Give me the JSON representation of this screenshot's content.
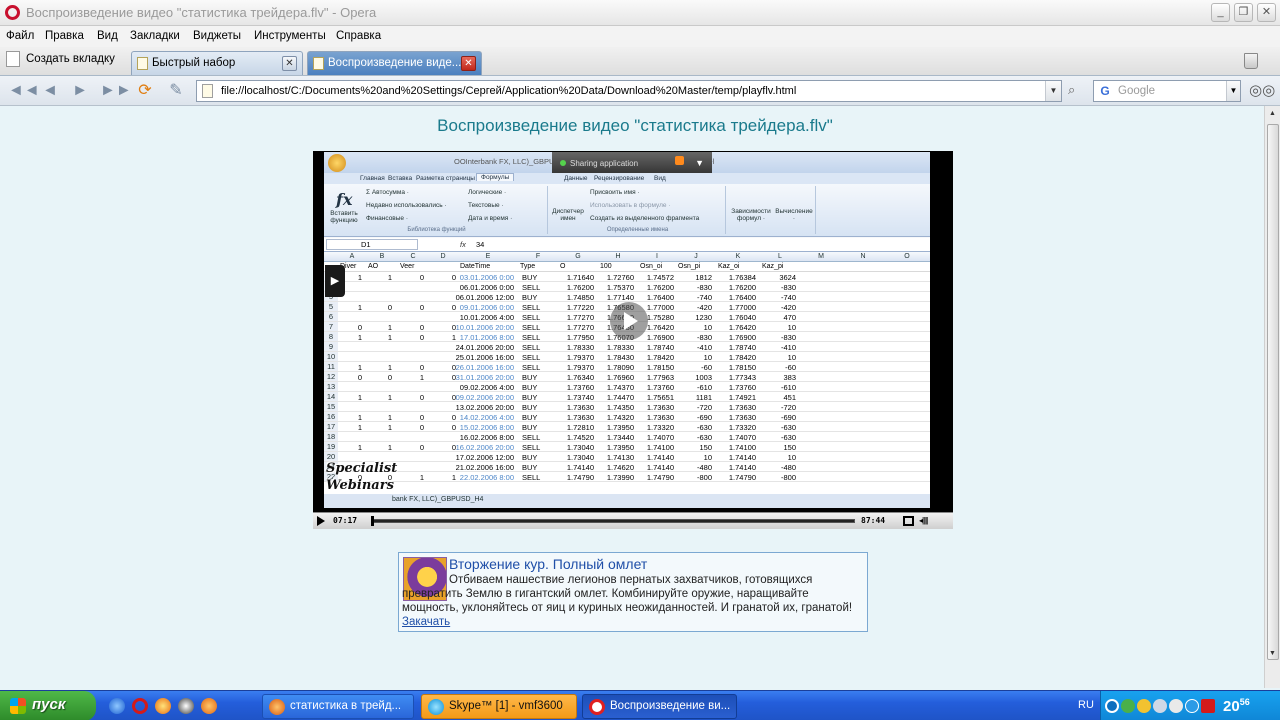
{
  "window": {
    "title": "Воспроизведение видео \"статистика трейдера.flv\" - Opera",
    "minimize": "_",
    "maximize": "❐",
    "close": "✕"
  },
  "menu": [
    "Файл",
    "Правка",
    "Вид",
    "Закладки",
    "Виджеты",
    "Инструменты",
    "Справка"
  ],
  "tabs": {
    "new_tab": "Создать вкладку",
    "items": [
      {
        "label": "Быстрый набор",
        "active": false
      },
      {
        "label": "Воспроизведение виде...",
        "active": true
      }
    ],
    "close_glyph": "✕"
  },
  "nav": {
    "back": "◄◄",
    "back_single": "◄",
    "forward_single": "►",
    "forward": "►►",
    "reload": "⟳",
    "edit": "✎",
    "url": "file://localhost/C:/Documents%20and%20Settings/Сергей/Application%20Data/Download%20Master/temp/playflv.html",
    "search_placeholder": "Google",
    "search_engine_glyph": "G",
    "dropdown_glyph": "▼"
  },
  "page": {
    "heading": "Воспроизведение видео \"статистика трейдера.flv\""
  },
  "video": {
    "excel_title": "OOInterbank FX, LLC)_GBPUSD... (Режим совместимости) - Microsoft Excel",
    "sharing_label": "Sharing application",
    "ribbon_tabs": [
      "Главная",
      "Вставка",
      "Разметка страницы",
      "Формулы",
      "Данные",
      "Рецензирование",
      "Вид"
    ],
    "active_ribbon_tab": "Формулы",
    "ribbon": {
      "insert_function": "Вставить функцию",
      "autosum": "Σ Автосумма ·",
      "recent": "Недавно использовались ·",
      "financial": "Финансовые ·",
      "logical": "Логические ·",
      "text": "Текстовые ·",
      "datetime": "Дата и время ·",
      "lib_caption": "Библиотека функций",
      "name_manager": "Диспетчер имен",
      "assign_name": "Присвоить имя ·",
      "use_in_formula": "Использовать в формуле ·",
      "create_from_sel": "Создать из выделенного фрагмента",
      "names_caption": "Определенные имена",
      "dependencies": "Зависимости формул ·",
      "calculation": "Вычисление ·"
    },
    "name_box": "D1",
    "formula_value": "34",
    "fx_label": "fx",
    "columns": [
      "A",
      "B",
      "C",
      "D",
      "E",
      "F",
      "G",
      "H",
      "I",
      "J",
      "K",
      "L",
      "M",
      "N",
      "O"
    ],
    "header_row": [
      "Diver",
      "AO",
      "Veer",
      "",
      "DateTime",
      "Type",
      "O",
      "100",
      "Osn_oi",
      "Osn_pi",
      "Kaz_oi",
      "Kaz_pi"
    ],
    "rows": [
      {
        "n": "3",
        "a": "1",
        "b": "1",
        "c": "0",
        "d": "0",
        "dt": "03.01.2006 0:00",
        "blue": true,
        "type": "BUY",
        "g": "1.71640",
        "h": "1.72760",
        "i": "1.74572",
        "j": "1812",
        "k": "1.76384",
        "l": "3624"
      },
      {
        "n": "4",
        "a": "",
        "b": "",
        "c": "",
        "d": "",
        "dt": "06.01.2006 0:00",
        "blue": false,
        "type": "SELL",
        "g": "1.76200",
        "h": "1.75370",
        "i": "1.76200",
        "j": "-830",
        "k": "1.76200",
        "l": "-830"
      },
      {
        "n": "5",
        "a": "",
        "b": "",
        "c": "",
        "d": "",
        "dt": "06.01.2006 12:00",
        "blue": false,
        "type": "BUY",
        "g": "1.74850",
        "h": "1.77140",
        "i": "1.76400",
        "j": "-740",
        "k": "1.76400",
        "l": "-740"
      },
      {
        "n": "5",
        "a": "1",
        "b": "0",
        "c": "0",
        "d": "0",
        "dt": "09.01.2006 0:00",
        "blue": true,
        "type": "SELL",
        "g": "1.77220",
        "h": "1.76580",
        "i": "1.77000",
        "j": "-420",
        "k": "1.77000",
        "l": "-420"
      },
      {
        "n": "6",
        "a": "",
        "b": "",
        "c": "",
        "d": "",
        "dt": "10.01.2006 4:00",
        "blue": false,
        "type": "SELL",
        "g": "1.77270",
        "h": "1.76610",
        "i": "1.75280",
        "j": "1230",
        "k": "1.76040",
        "l": "470"
      },
      {
        "n": "7",
        "a": "0",
        "b": "1",
        "c": "0",
        "d": "0",
        "dt": "10.01.2006 20:00",
        "blue": true,
        "type": "SELL",
        "g": "1.77270",
        "h": "1.76430",
        "i": "1.76420",
        "j": "10",
        "k": "1.76420",
        "l": "10"
      },
      {
        "n": "8",
        "a": "1",
        "b": "1",
        "c": "0",
        "d": "1",
        "dt": "17.01.2006 8:00",
        "blue": true,
        "type": "SELL",
        "g": "1.77950",
        "h": "1.76070",
        "i": "1.76900",
        "j": "-830",
        "k": "1.76900",
        "l": "-830"
      },
      {
        "n": "9",
        "a": "",
        "b": "",
        "c": "",
        "d": "",
        "dt": "24.01.2006 20:00",
        "blue": false,
        "type": "SELL",
        "g": "1.78330",
        "h": "1.78330",
        "i": "1.78740",
        "j": "-410",
        "k": "1.78740",
        "l": "-410"
      },
      {
        "n": "10",
        "a": "",
        "b": "",
        "c": "",
        "d": "",
        "dt": "25.01.2006 16:00",
        "blue": false,
        "type": "SELL",
        "g": "1.79370",
        "h": "1.78430",
        "i": "1.78420",
        "j": "10",
        "k": "1.78420",
        "l": "10"
      },
      {
        "n": "11",
        "a": "1",
        "b": "1",
        "c": "0",
        "d": "0",
        "dt": "26.01.2006 16:00",
        "blue": true,
        "type": "SELL",
        "g": "1.79370",
        "h": "1.78090",
        "i": "1.78150",
        "j": "-60",
        "k": "1.78150",
        "l": "-60"
      },
      {
        "n": "12",
        "a": "0",
        "b": "0",
        "c": "1",
        "d": "0",
        "dt": "31.01.2006 20:00",
        "blue": true,
        "type": "BUY",
        "g": "1.76340",
        "h": "1.76960",
        "i": "1.77963",
        "j": "1003",
        "k": "1.77343",
        "l": "383"
      },
      {
        "n": "13",
        "a": "",
        "b": "",
        "c": "",
        "d": "",
        "dt": "09.02.2006 4:00",
        "blue": false,
        "type": "BUY",
        "g": "1.73760",
        "h": "1.74370",
        "i": "1.73760",
        "j": "-610",
        "k": "1.73760",
        "l": "-610"
      },
      {
        "n": "14",
        "a": "1",
        "b": "1",
        "c": "0",
        "d": "0",
        "dt": "09.02.2006 20:00",
        "blue": true,
        "type": "BUY",
        "g": "1.73740",
        "h": "1.74470",
        "i": "1.75651",
        "j": "1181",
        "k": "1.74921",
        "l": "451"
      },
      {
        "n": "15",
        "a": "",
        "b": "",
        "c": "",
        "d": "",
        "dt": "13.02.2006 20:00",
        "blue": false,
        "type": "BUY",
        "g": "1.73630",
        "h": "1.74350",
        "i": "1.73630",
        "j": "-720",
        "k": "1.73630",
        "l": "-720"
      },
      {
        "n": "16",
        "a": "1",
        "b": "1",
        "c": "0",
        "d": "0",
        "dt": "14.02.2006 4:00",
        "blue": true,
        "type": "BUY",
        "g": "1.73630",
        "h": "1.74320",
        "i": "1.73630",
        "j": "-690",
        "k": "1.73630",
        "l": "-690"
      },
      {
        "n": "17",
        "a": "1",
        "b": "1",
        "c": "0",
        "d": "0",
        "dt": "15.02.2006 8:00",
        "blue": true,
        "type": "BUY",
        "g": "1.72810",
        "h": "1.73950",
        "i": "1.73320",
        "j": "-630",
        "k": "1.73320",
        "l": "-630"
      },
      {
        "n": "18",
        "a": "",
        "b": "",
        "c": "",
        "d": "",
        "dt": "16.02.2006 8:00",
        "blue": false,
        "type": "SELL",
        "g": "1.74520",
        "h": "1.73440",
        "i": "1.74070",
        "j": "-630",
        "k": "1.74070",
        "l": "-630"
      },
      {
        "n": "19",
        "a": "1",
        "b": "1",
        "c": "0",
        "d": "0",
        "dt": "16.02.2006 20:00",
        "blue": true,
        "type": "SELL",
        "g": "1.73040",
        "h": "1.73950",
        "i": "1.74100",
        "j": "150",
        "k": "1.74100",
        "l": "150"
      },
      {
        "n": "20",
        "a": "",
        "b": "",
        "c": "",
        "d": "",
        "dt": "17.02.2006 12:00",
        "blue": false,
        "type": "BUY",
        "g": "1.73040",
        "h": "1.74130",
        "i": "1.74140",
        "j": "10",
        "k": "1.74140",
        "l": "10"
      },
      {
        "n": "21",
        "a": "",
        "b": "",
        "c": "",
        "d": "",
        "dt": "21.02.2006 16:00",
        "blue": false,
        "type": "BUY",
        "g": "1.74140",
        "h": "1.74620",
        "i": "1.74140",
        "j": "-480",
        "k": "1.74140",
        "l": "-480"
      },
      {
        "n": "22",
        "a": "0",
        "b": "0",
        "c": "1",
        "d": "1",
        "dt": "22.02.2006 8:00",
        "blue": true,
        "type": "SELL",
        "g": "1.74790",
        "h": "1.73990",
        "i": "1.74790",
        "j": "-800",
        "k": "1.74790",
        "l": "-800"
      }
    ],
    "sheet_tab": "bank FX, LLC)_GBPUSD_H4",
    "watermark_line1": "Specialist",
    "watermark_line2": "Webinars",
    "time_current": "07:17",
    "time_total": "87:44",
    "progress": 0.0
  },
  "ad": {
    "title": "Вторжение кур. Полный омлет",
    "description": "Отбиваем нашествие легионов пернатых захватчиков, готовящихся превратить Землю в гигантский омлет. Комбинируйте оружие, наращивайте мощность, уклоняйтесь от яиц и куриных неожиданностей. И гранатой их, гранатой!",
    "link": "Закачать"
  },
  "taskbar": {
    "start": "пуск",
    "tasks": [
      {
        "label": "статистика в трейд...",
        "kind": "normal"
      },
      {
        "label": "Skype™ [1] - vmf3600",
        "kind": "skype"
      },
      {
        "label": "Воспроизведение ви...",
        "kind": "active"
      }
    ],
    "lang": "RU",
    "clock_hour": "20",
    "clock_minute": "56"
  },
  "colors": {
    "heading": "#1a7a8c",
    "ad_title": "#1f4fa8",
    "taskbar": "#245edb",
    "start": "#2d8a2a"
  }
}
